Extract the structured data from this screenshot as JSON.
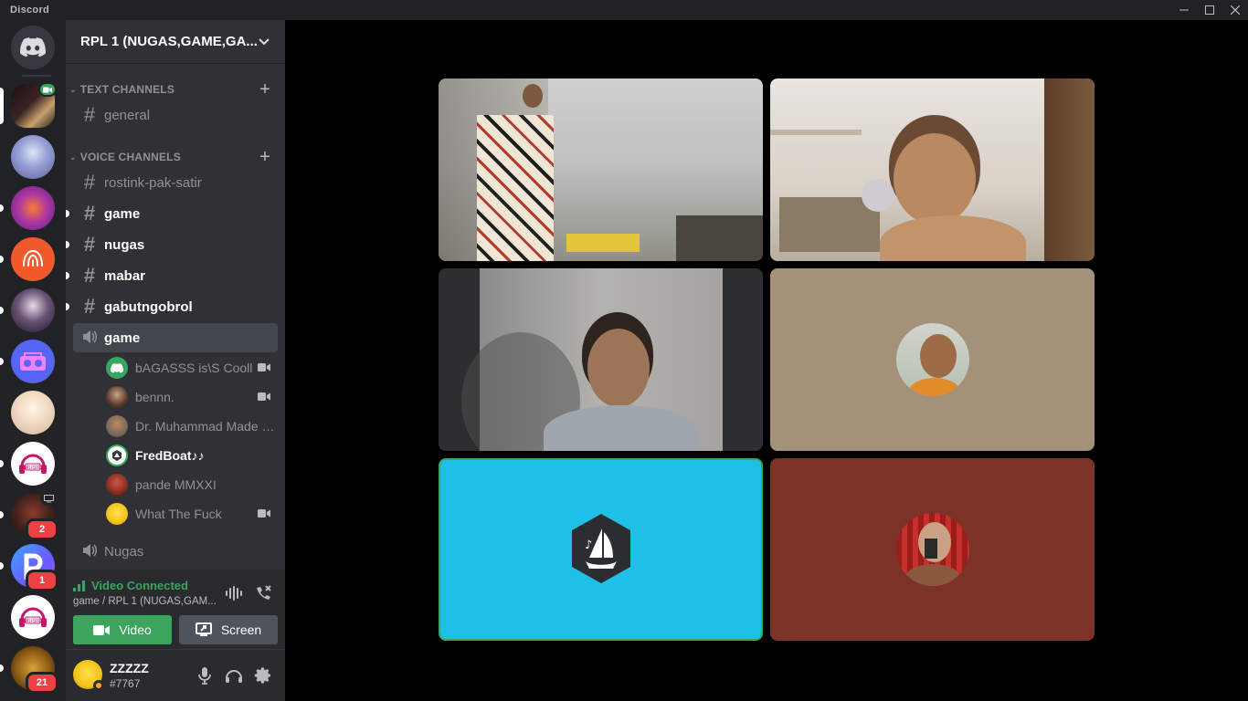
{
  "app": {
    "title": "Discord"
  },
  "guild": {
    "name": "RPL 1 (NUGAS,GAME,GA..."
  },
  "categories": {
    "text": "TEXT CHANNELS",
    "voice": "VOICE CHANNELS"
  },
  "text_channels": [
    {
      "name": "general"
    }
  ],
  "voice_channels": [
    {
      "name": "rostink-pak-satir"
    },
    {
      "name": "game"
    },
    {
      "name": "nugas"
    },
    {
      "name": "mabar"
    },
    {
      "name": "gabutngobrol"
    },
    {
      "name": "game"
    }
  ],
  "voice_users": [
    {
      "name": "bAGASSS is\\S Cooll",
      "camera": true
    },
    {
      "name": "bennn.",
      "camera": true
    },
    {
      "name": "Dr. Muhammad Made m...",
      "camera": false
    },
    {
      "name": "FredBoat♪♪",
      "camera": false
    },
    {
      "name": "pande MMXXI",
      "camera": false
    },
    {
      "name": "What The Fuck",
      "camera": true
    }
  ],
  "extra_voice_channel": {
    "name": "Nugas"
  },
  "voice_panel": {
    "status": "Video Connected",
    "location": "game / RPL 1 (NUGAS,GAM...",
    "video_label": "Video",
    "screen_label": "Screen"
  },
  "user": {
    "name": "ZZZZZ",
    "tag": "#7767"
  },
  "server_badges": {
    "s10": "2",
    "s11": "1",
    "s13": "21"
  },
  "colors": {
    "accent_green": "#3ba55d",
    "blurple": "#5865f2",
    "fredboat_tile": "#1ec0e6",
    "tile_tan": "#a4917a",
    "tile_red": "#7b3327"
  }
}
